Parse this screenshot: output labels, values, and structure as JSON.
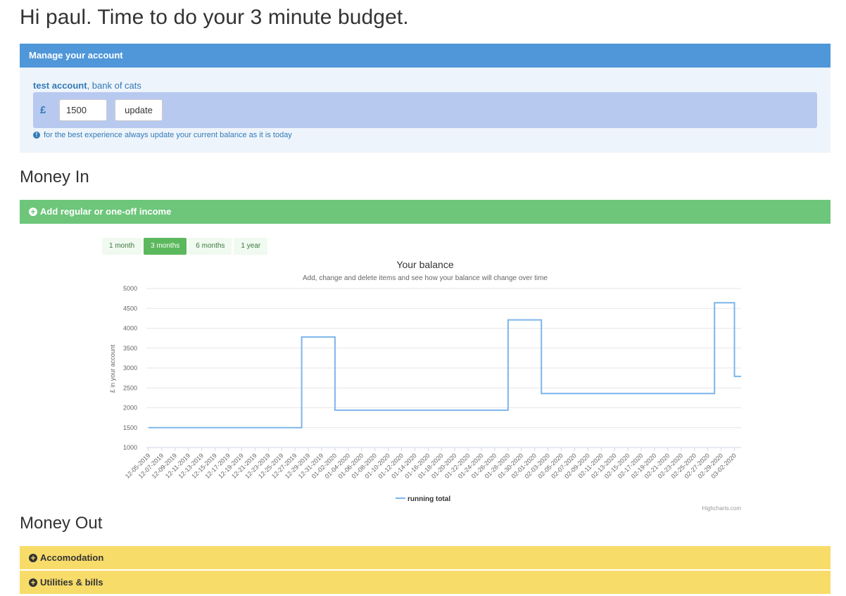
{
  "greeting": "Hi paul. Time to do your 3 minute budget.",
  "account_panel": {
    "header": "Manage your account",
    "account_name": "test account",
    "bank_suffix": ", bank of cats",
    "currency_symbol": "£",
    "balance_value": "1500",
    "update_label": "update",
    "tip": "for the best experience always update your current balance as it is today",
    "tip_icon": "info-circle-icon"
  },
  "money_in": {
    "heading": "Money In",
    "add_label": "Add regular or one-off income",
    "add_icon": "plus-circle-icon",
    "range_buttons": [
      {
        "label": "1 month",
        "active": false
      },
      {
        "label": "3 months",
        "active": true
      },
      {
        "label": "6 months",
        "active": false
      },
      {
        "label": "1 year",
        "active": false
      }
    ]
  },
  "money_out": {
    "heading": "Money Out",
    "categories": [
      {
        "label": "Accomodation",
        "icon": "plus-circle-icon"
      },
      {
        "label": "Utilities & bills",
        "icon": "plus-circle-icon"
      }
    ]
  },
  "colors": {
    "account_header": "#4f97d9",
    "income_bar": "#6dc67a",
    "expense_bar": "#f8dc6a",
    "series_line": "#7cb5ec"
  },
  "chart_data": {
    "type": "line",
    "title": "Your balance",
    "subtitle": "Add, change and delete items and see how your balance will change over time",
    "xlabel": "",
    "ylabel": "£ in your account",
    "ylim": [
      1000,
      5000
    ],
    "yticks": [
      1000,
      1500,
      2000,
      2500,
      3000,
      3500,
      4000,
      4500,
      5000
    ],
    "x_tick_labels": [
      "12-05-2019",
      "12-07-2019",
      "12-09-2019",
      "12-11-2019",
      "12-13-2019",
      "12-15-2019",
      "12-17-2019",
      "12-19-2019",
      "12-21-2019",
      "12-23-2019",
      "12-25-2019",
      "12-27-2019",
      "12-29-2019",
      "12-31-2019",
      "01-02-2020",
      "01-04-2020",
      "01-06-2020",
      "01-08-2020",
      "01-10-2020",
      "01-12-2020",
      "01-14-2020",
      "01-16-2020",
      "01-18-2020",
      "01-20-2020",
      "01-22-2020",
      "01-24-2020",
      "01-26-2020",
      "01-28-2020",
      "01-30-2020",
      "02-01-2020",
      "02-03-2020",
      "02-05-2020",
      "02-07-2020",
      "02-09-2020",
      "02-11-2020",
      "02-13-2020",
      "02-15-2020",
      "02-17-2020",
      "02-19-2020",
      "02-21-2020",
      "02-23-2020",
      "02-25-2020",
      "02-27-2020",
      "02-29-2020",
      "03-02-2020"
    ],
    "grid": true,
    "legend_position": "bottom-center",
    "credit": "Highcharts.com",
    "series": [
      {
        "name": "running total",
        "color": "#7cb5ec",
        "step": true,
        "points": [
          {
            "x": "12-05-2019",
            "y": 1500
          },
          {
            "x": "12-28-2019",
            "y": 3780
          },
          {
            "x": "01-02-2020",
            "y": 1940
          },
          {
            "x": "01-28-2020",
            "y": 4210
          },
          {
            "x": "02-02-2020",
            "y": 2360
          },
          {
            "x": "02-28-2020",
            "y": 4640
          },
          {
            "x": "03-02-2020",
            "y": 2790
          },
          {
            "x": "03-03-2020",
            "y": 2790
          }
        ]
      }
    ]
  }
}
